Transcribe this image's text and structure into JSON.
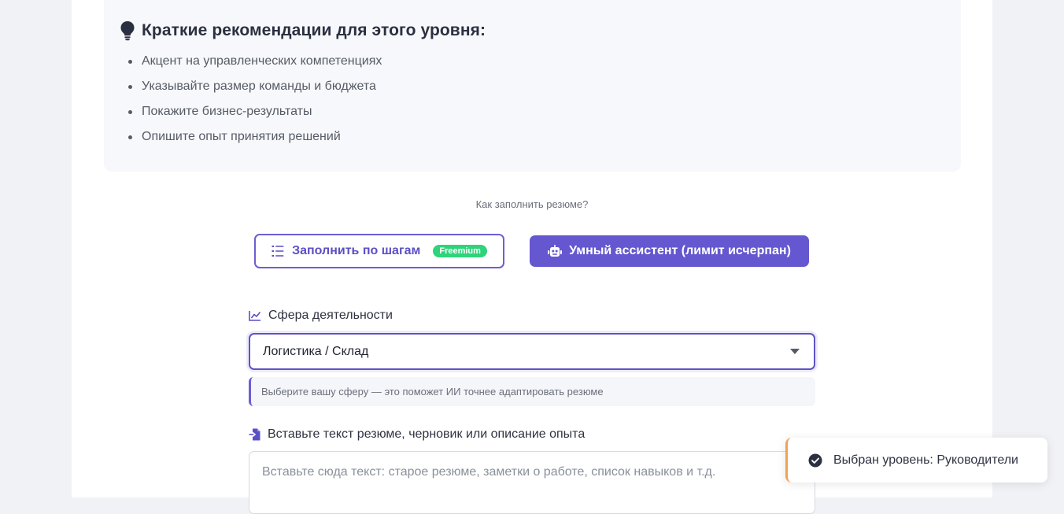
{
  "tips": {
    "title": "Краткие рекомендации для этого уровня:",
    "icon": "lightbulb-icon",
    "items": [
      "Акцент на управленческих компетенциях",
      "Указывайте размер команды и бюджета",
      "Покажите бизнес-результаты",
      "Опишите опыт принятия решений"
    ]
  },
  "fill_mode": {
    "question": "Как заполнить резюме?",
    "steps_button": {
      "label": "Заполнить по шагам",
      "badge": "Freemium",
      "icon": "list-ordered-icon"
    },
    "ai_button": {
      "label": "Умный ассистент (лимит исчерпан)",
      "icon": "robot-icon"
    }
  },
  "sphere": {
    "label": "Сфера деятельности",
    "icon": "line-chart-icon",
    "selected": "Логистика / Склад",
    "hint": "Выберите вашу сферу — это поможет ИИ точнее адаптировать резюме"
  },
  "resume_text": {
    "label": "Вставьте текст резюме, черновик или описание опыта",
    "icon": "file-import-icon",
    "placeholder": "Вставьте сюда текст: старое резюме, заметки о работе, список навыков и т.д.",
    "value": ""
  },
  "toast": {
    "message": "Выбран уровень: Руководители",
    "icon": "check-circle-icon",
    "accent": "#f2a152"
  },
  "colors": {
    "primary": "#6557cf",
    "badge": "#2ed47a"
  }
}
